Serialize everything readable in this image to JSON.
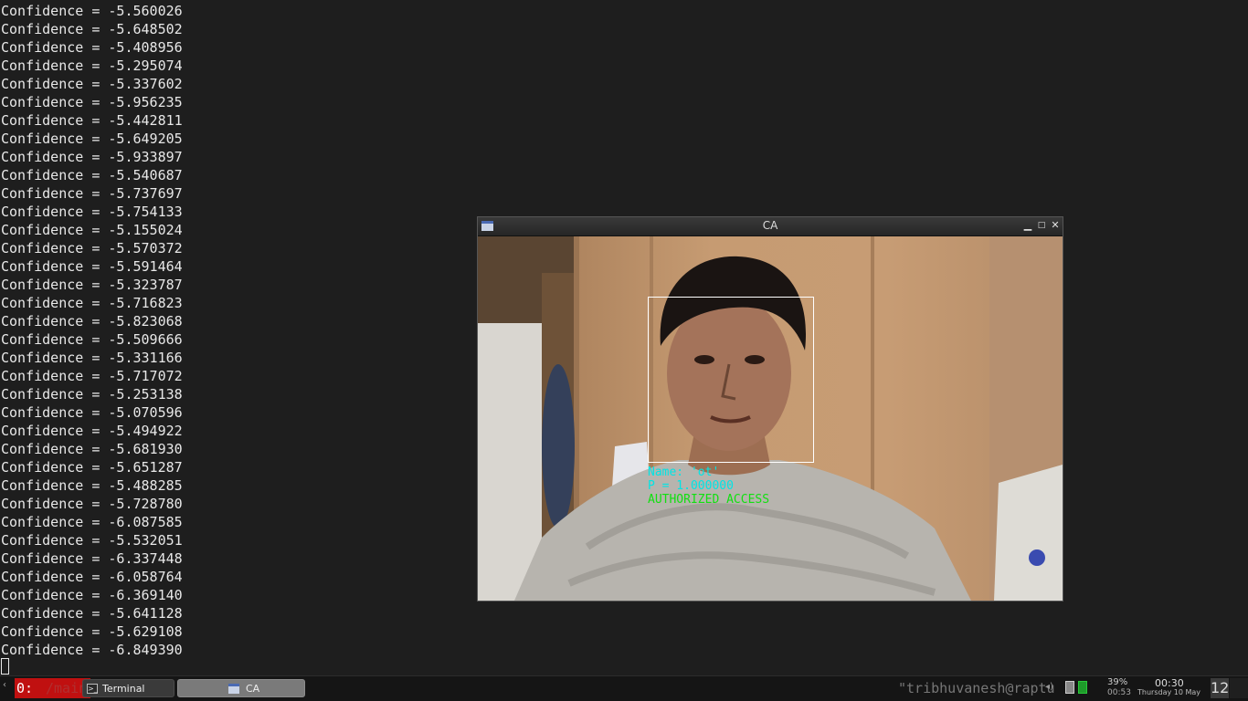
{
  "terminal": {
    "lines": [
      "Confidence = -5.560026",
      "Confidence = -5.648502",
      "Confidence = -5.408956",
      "Confidence = -5.295074",
      "Confidence = -5.337602",
      "Confidence = -5.956235",
      "Confidence = -5.442811",
      "Confidence = -5.649205",
      "Confidence = -5.933897",
      "Confidence = -5.540687",
      "Confidence = -5.737697",
      "Confidence = -5.754133",
      "Confidence = -5.155024",
      "Confidence = -5.570372",
      "Confidence = -5.591464",
      "Confidence = -5.323787",
      "Confidence = -5.716823",
      "Confidence = -5.823068",
      "Confidence = -5.509666",
      "Confidence = -5.331166",
      "Confidence = -5.717072",
      "Confidence = -5.253138",
      "Confidence = -5.070596",
      "Confidence = -5.494922",
      "Confidence = -5.681930",
      "Confidence = -5.651287",
      "Confidence = -5.488285",
      "Confidence = -5.728780",
      "Confidence = -6.087585",
      "Confidence = -5.532051",
      "Confidence = -6.337448",
      "Confidence = -6.058764",
      "Confidence = -6.369140",
      "Confidence = -5.641128",
      "Confidence = -5.629108",
      "Confidence = -6.849390"
    ]
  },
  "ca_window": {
    "title": "CA",
    "overlay": {
      "name_line": "Name: 'ot'",
      "probability_line": "P = 1.000000",
      "status_line": "AUTHORIZED ACCESS"
    }
  },
  "taskbar": {
    "tmux_window": "0:",
    "tmux_path": "/main",
    "tasks": [
      {
        "label": "Terminal",
        "icon": "terminal-icon"
      },
      {
        "label": "CA",
        "icon": "window-icon"
      }
    ],
    "host_status": "\"tribhuvanesh@raptu",
    "battery_percent": "39%",
    "battery_time": "00:53",
    "clock_time": "00:30",
    "clock_date": "Thursday 10 May",
    "corner_number": "12"
  },
  "colors": {
    "terminal_bg": "#1e1e1e",
    "overlay_cyan": "#00e5e5",
    "overlay_green": "#11e011",
    "tmux_red": "#c01010"
  }
}
